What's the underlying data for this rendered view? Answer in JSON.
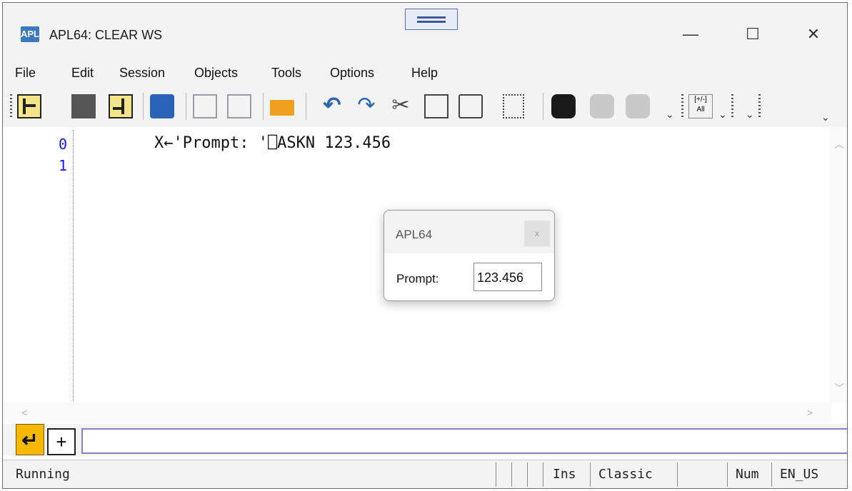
{
  "window": {
    "title": "APL64: CLEAR WS",
    "icon": "apl64-app-icon",
    "minimize": "—",
    "maximize": "☐",
    "close": "✕"
  },
  "menu": [
    "File",
    "Edit",
    "Session",
    "Objects",
    "Tools",
    "Options",
    "Help"
  ],
  "toolbar": {
    "buttons": [
      "step-into-icon",
      "step-over-icon",
      "step-out-icon",
      "print-icon",
      "new-icon",
      "document-icon",
      "open-folder-icon",
      "undo-icon",
      "redo-icon",
      "cut-icon",
      "copy-icon",
      "paste-icon",
      "select-icon",
      "find-icon",
      "find-previous-icon",
      "find-next-icon",
      "toggle-sign-icon"
    ],
    "toggle_label_top": "[+/-]",
    "toggle_label_bottom": "All",
    "overflow": "⌄"
  },
  "editor": {
    "line_numbers": [
      "0",
      "1"
    ],
    "code_line": "X←'Prompt: '⎕ASKN 123.456"
  },
  "dialog": {
    "title": "APL64",
    "close": "x",
    "label": "Prompt:",
    "value": "123.456"
  },
  "input_bar": {
    "enter_symbol": "↵",
    "plus_symbol": "+"
  },
  "statusbar": {
    "status": "Running",
    "mode": "Ins",
    "keyboard": "Classic",
    "num": "Num",
    "locale": "EN_US"
  },
  "colors": {
    "line_number": "#1414ff",
    "enter_button": "#f5b700",
    "input_border": "#8880c8"
  }
}
